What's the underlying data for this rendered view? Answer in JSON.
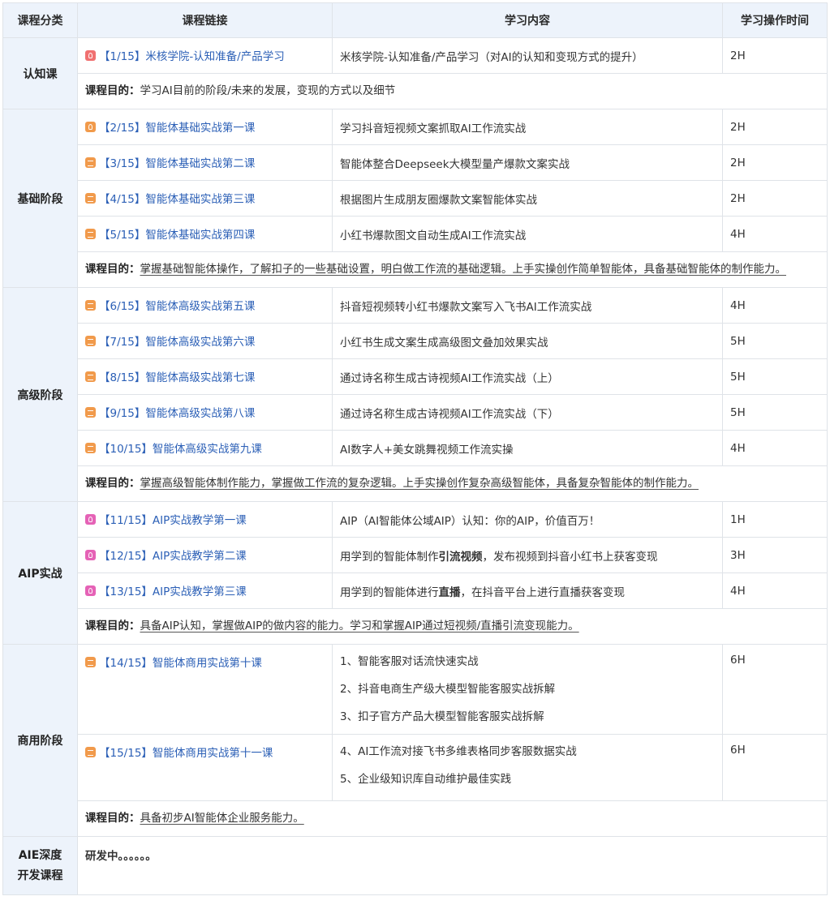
{
  "headers": [
    "课程分类",
    "课程链接",
    "学习内容",
    "学习操作时间"
  ],
  "purpose_label": "课程目的：",
  "colors": {
    "header_bg": "#edf3fb",
    "link": "#2b5fb6",
    "icon_orange": "#f19a4b",
    "icon_pink": "#e562b6",
    "icon_red": "#f07070"
  },
  "sections": [
    {
      "category": "认知课",
      "rows": [
        {
          "icon": "bulb-icon",
          "icon_color": "#f07070",
          "link": "【1/15】米核学院-认知准备/产品学习",
          "content": "米核学院-认知准备/产品学习（对AI的认知和变现方式的提升）",
          "time": "2H"
        }
      ],
      "purpose": "学习AI目前的阶段/未来的发展，变现的方式以及细节"
    },
    {
      "category": "基础阶段",
      "rows": [
        {
          "icon": "bulb-icon",
          "icon_color": "#f19a4b",
          "link": "【2/15】智能体基础实战第一课",
          "content": "学习抖音短视频文案抓取AI工作流实战",
          "time": "2H"
        },
        {
          "icon": "doc-icon",
          "icon_color": "#f19a4b",
          "link": "【3/15】智能体基础实战第二课",
          "content": "智能体整合Deepseek大模型量产爆款文案实战",
          "time": "2H"
        },
        {
          "icon": "doc-icon",
          "icon_color": "#f19a4b",
          "link": "【4/15】智能体基础实战第三课",
          "content": "根据图片生成朋友圈爆款文案智能体实战",
          "time": "2H"
        },
        {
          "icon": "doc-icon",
          "icon_color": "#f19a4b",
          "link": "【5/15】智能体基础实战第四课",
          "content": "小红书爆款图文自动生成AI工作流实战",
          "time": "4H"
        }
      ],
      "purpose": "掌握基础智能体操作，了解扣子的一些基础设置，明白做工作流的基础逻辑。上手实操创作简单智能体，具备基础智能体的制作能力。"
    },
    {
      "category": "高级阶段",
      "rows": [
        {
          "icon": "doc-icon",
          "icon_color": "#f19a4b",
          "link": "【6/15】智能体高级实战第五课",
          "content": "抖音短视频转小红书爆款文案写入飞书AI工作流实战",
          "time": "4H"
        },
        {
          "icon": "doc-icon",
          "icon_color": "#f19a4b",
          "link": "【7/15】智能体高级实战第六课",
          "content": "小红书生成文案生成高级图文叠加效果实战",
          "time": "5H"
        },
        {
          "icon": "doc-icon",
          "icon_color": "#f19a4b",
          "link": "【8/15】智能体高级实战第七课",
          "content": "通过诗名称生成古诗视频AI工作流实战（上）",
          "time": "5H"
        },
        {
          "icon": "doc-icon",
          "icon_color": "#f19a4b",
          "link": "【9/15】智能体高级实战第八课",
          "content": "通过诗名称生成古诗视频AI工作流实战（下）",
          "time": "5H"
        },
        {
          "icon": "doc-icon",
          "icon_color": "#f19a4b",
          "link": "【10/15】智能体高级实战第九课",
          "content": "AI数字人+美女跳舞视频工作流实操",
          "time": "4H"
        }
      ],
      "purpose": "掌握高级智能体制作能力，掌握做工作流的复杂逻辑。上手实操创作复杂高级智能体，具备复杂智能体的制作能力。"
    },
    {
      "category": "AIP实战",
      "rows": [
        {
          "icon": "bulb-icon",
          "icon_color": "#e562b6",
          "link": "【11/15】AIP实战教学第一课",
          "content": "AIP（AI智能体公域AIP）认知：你的AIP，价值百万！",
          "time": "1H"
        },
        {
          "icon": "bulb-icon",
          "icon_color": "#e562b6",
          "link": "【12/15】AIP实战教学第二课",
          "content_pre": "用学到的智能体制作",
          "content_bold": "引流视频",
          "content_post": "，发布视频到抖音小红书上获客变现",
          "time": "3H"
        },
        {
          "icon": "bulb-icon",
          "icon_color": "#e562b6",
          "link": "【13/15】AIP实战教学第三课",
          "content_pre": "用学到的智能体进行",
          "content_bold": "直播",
          "content_post": "，在抖音平台上进行直播获客变现",
          "time": "4H"
        }
      ],
      "purpose": "具备AIP认知，掌握做AIP的做内容的能力。学习和掌握AIP通过短视频/直播引流变现能力。"
    },
    {
      "category": "商用阶段",
      "rows": [
        {
          "icon": "doc-icon",
          "icon_color": "#f19a4b",
          "link": "【14/15】智能体商用实战第十课",
          "lines": [
            "1、智能客服对话流快速实战",
            "2、抖音电商生产级大模型智能客服实战拆解",
            "3、扣子官方产品大模型智能客服实战拆解"
          ],
          "time": "6H"
        },
        {
          "icon": "doc-icon",
          "icon_color": "#f19a4b",
          "link": "【15/15】智能体商用实战第十一课",
          "lines": [
            "4、AI工作流对接飞书多维表格同步客服数据实战",
            "5、企业级知识库自动维护最佳实践"
          ],
          "time": "6H"
        }
      ],
      "purpose": "具备初步AI智能体企业服务能力。"
    }
  ],
  "last": {
    "category_line1": "AIE深度",
    "category_line2": "开发课程",
    "text": "研发中。。。。。。"
  }
}
